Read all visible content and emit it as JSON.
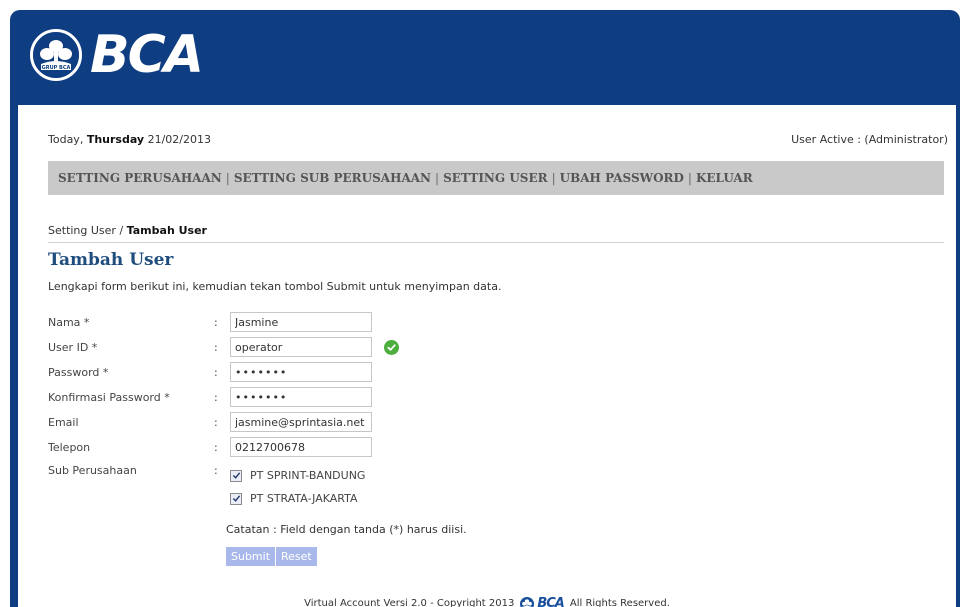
{
  "brand": {
    "name": "BCA",
    "emblem_caption": "GRUP BCA",
    "colors": {
      "primary": "#0f3d82",
      "nav_bg": "#c9c9c9",
      "title": "#1f4d7e",
      "button": "#a9b8ea",
      "check": "#4cae3c"
    }
  },
  "topline": {
    "today_prefix": "Today, ",
    "day": "Thursday",
    "date": " 21/02/2013",
    "user_active": "User Active : (Administrator)"
  },
  "nav": {
    "items": [
      {
        "label": "SETTING PERUSAHAAN"
      },
      {
        "label": "SETTING SUB PERUSAHAAN"
      },
      {
        "label": "SETTING USER"
      },
      {
        "label": "UBAH PASSWORD"
      },
      {
        "label": "KELUAR"
      }
    ],
    "separator": "|"
  },
  "breadcrumb": {
    "parent": "Setting User",
    "separator": " / ",
    "current": "Tambah User"
  },
  "page_title": "Tambah User",
  "intro": "Lengkapi form berikut ini, kemudian tekan tombol Submit untuk menyimpan data.",
  "form": {
    "colon": ":",
    "fields": [
      {
        "label": "Nama *",
        "value": "Jasmine"
      },
      {
        "label": "User ID *",
        "value": "operator",
        "status_icon": "check-circle-icon"
      },
      {
        "label": "Password *",
        "value": "•••••••"
      },
      {
        "label": "Konfirmasi Password *",
        "value": "•••••••"
      },
      {
        "label": "Email",
        "value": "jasmine@sprintasia.net"
      },
      {
        "label": "Telepon",
        "value": "0212700678"
      }
    ],
    "sub_perusahaan": {
      "label": "Sub Perusahaan",
      "options": [
        {
          "label": "PT SPRINT-BANDUNG",
          "checked": true
        },
        {
          "label": "PT STRATA-JAKARTA",
          "checked": true
        }
      ]
    },
    "note": "Catatan : Field dengan tanda (*) harus diisi.",
    "submit_label": "Submit",
    "reset_label": "Reset"
  },
  "footer": {
    "left": "Virtual Account Versi 2.0 - Copyright 2013",
    "logo_text": "BCA",
    "right": "All Rights Reserved."
  }
}
